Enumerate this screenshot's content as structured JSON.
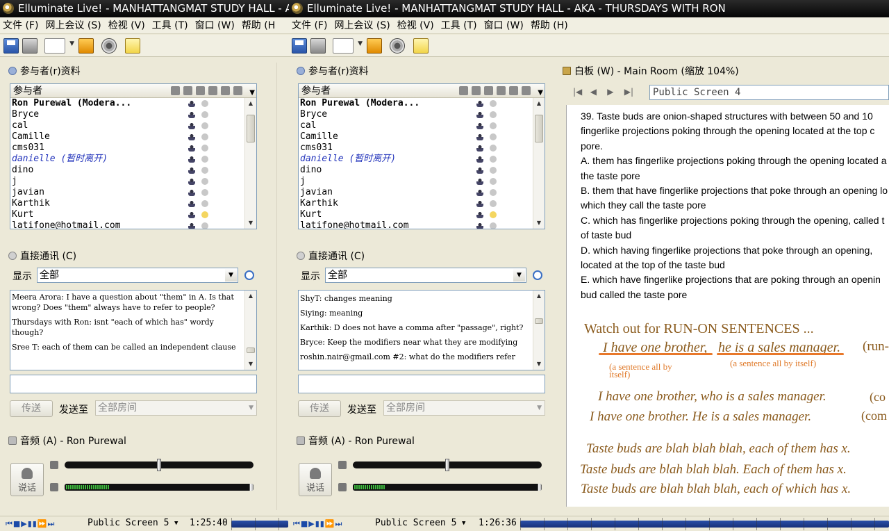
{
  "windows": [
    {
      "title": "Elluminate Live! - MANHATTANGMAT STUDY HALL - A"
    },
    {
      "title": "Elluminate Live! - MANHATTANGMAT STUDY HALL - AKA - THURSDAYS WITH RON"
    }
  ],
  "menus": {
    "left": [
      "文件 (F)",
      "网上会议 (S)",
      "检视 (V)",
      "工具 (T)",
      "窗口 (W)",
      "帮助 (H"
    ],
    "right": [
      "文件 (F)",
      "网上会议 (S)",
      "检视 (V)",
      "工具 (T)",
      "窗口 (W)",
      "帮助 (H)"
    ]
  },
  "participants": {
    "title": "参与者(r)资料",
    "header": "参与者",
    "rows": [
      {
        "name": "Ron Purewal (Modera...",
        "kind": "mod"
      },
      {
        "name": "Bryce",
        "kind": ""
      },
      {
        "name": "cal",
        "kind": ""
      },
      {
        "name": "Camille",
        "kind": ""
      },
      {
        "name": "cms031",
        "kind": ""
      },
      {
        "name": "danielle (暂时离开)",
        "kind": "away"
      },
      {
        "name": "dino",
        "kind": ""
      },
      {
        "name": "j",
        "kind": ""
      },
      {
        "name": "javian",
        "kind": ""
      },
      {
        "name": "Karthik",
        "kind": ""
      },
      {
        "name": "Kurt",
        "kind": "hl"
      },
      {
        "name": "latifone@hotmail.com",
        "kind": ""
      }
    ]
  },
  "chat": {
    "title": "直接通讯 (C)",
    "show_label": "显示",
    "show_value": "全部",
    "left_messages": [
      "Meera Arora: I have a question about \"them\" in A. Is that wrong? Does \"them\" always have to refer to people?",
      "Thursdays with Ron: isnt \"each of which has\" wordy though?",
      "Sree T: each of them can be called an independent clause"
    ],
    "right_messages": [
      "ShyT: changes meaning",
      "Siying: meaning",
      "Karthik: D does not have a comma after \"passage\", right?",
      "Bryce: Keep the modifiers near what they are modifying",
      "roshin.nair@gmail.com #2: what do the modifiers refer"
    ],
    "send_label": "传送",
    "send_to_label": "发送至",
    "room_value": "全部房间"
  },
  "audio": {
    "title": "音频 (A) - Ron Purewal",
    "talk_label": "说话",
    "left_mic_level": 0.5,
    "right_mic_level": 0.5
  },
  "whiteboard": {
    "title": "白板 (W) - Main Room (缩放 104%)",
    "screen_name": "Public Screen 4",
    "question": [
      {
        "text": "39. Taste buds are onion-shaped structures with between 50 and 10",
        "ul": false
      },
      {
        "text": "fingerlike projections poking through the opening located at the top c",
        "ul": true
      },
      {
        "text": "pore.",
        "ul": true
      },
      {
        "text": "A. them has fingerlike projections poking through the opening located a",
        "ul": false
      },
      {
        "text": "the taste pore",
        "ul": false
      },
      {
        "text": "B. them that have fingerlike projections that poke through an opening lo",
        "ul": false
      },
      {
        "text": "which they call the taste pore",
        "ul": false
      },
      {
        "text": "C. which has fingerlike projections poking through the opening, called t",
        "ul": false
      },
      {
        "text": "of taste bud",
        "ul": false
      },
      {
        "text": "D. which having fingerlike projections that poke through an opening,",
        "ul": false
      },
      {
        "text": "located at the top of the taste bud",
        "ul": false
      },
      {
        "text": "E. which have fingerlike projections that are poking through an openin",
        "ul": false
      },
      {
        "text": "bud called the taste pore",
        "ul": false
      }
    ],
    "handwriting": {
      "heading": "Watch out for RUN-ON SENTENCES ...",
      "ex1a": "I have one brother,",
      "ex1b": "he is a sales manager.",
      "ex1tag": "(run-",
      "note1": "(a sentence all by itself)",
      "note2": "(a sentence all by itself)",
      "ex2": "I have one brother, who is a sales manager.",
      "ex2tag": "(co",
      "ex3": "I have one brother.  He is a sales manager.",
      "ex3tag": "(com",
      "ex4": "Taste buds are blah blah blah, each of them has x.",
      "ex5": "Taste buds are blah blah blah.  Each of them has x.",
      "ex6": "Taste buds are blah blah blah, each of which has x."
    }
  },
  "status": {
    "left_screen": "Public Screen 5",
    "left_time": "1:25:40",
    "right_screen": "Public Screen 5",
    "right_time": "1:26:36"
  }
}
